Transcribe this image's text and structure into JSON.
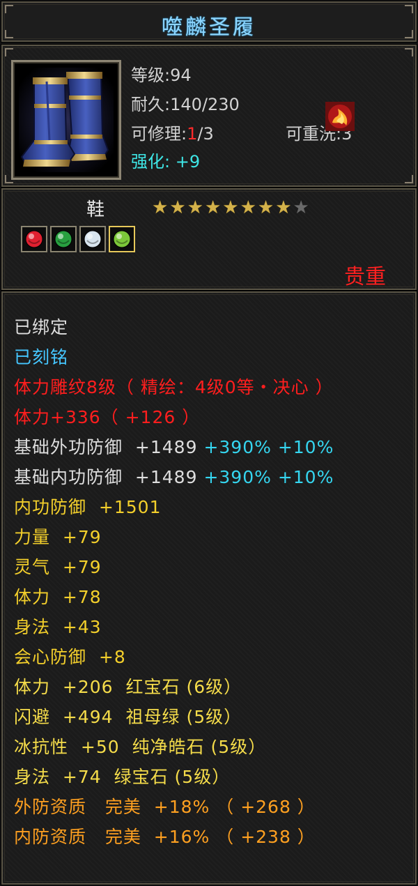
{
  "title": "噬麟圣履",
  "info": {
    "level_label": "等级:",
    "level_value": "94",
    "durability_label": "耐久:",
    "durability_value": "140/230",
    "repair_label": "可修理:",
    "repair_current": "1",
    "repair_max": "/3",
    "reset_label": "可重洗:",
    "reset_value": "3",
    "enhance_label": "强化:",
    "enhance_value": "+9",
    "item_icon": "blue-boots-icon",
    "element_icon": "fire-phoenix-icon"
  },
  "item_type": "鞋",
  "stars": {
    "filled": 8,
    "total": 9
  },
  "gems": [
    {
      "name": "red-gem-icon",
      "color": "#e02030"
    },
    {
      "name": "emerald-gem-icon",
      "color": "#28a040"
    },
    {
      "name": "white-gem-icon",
      "color": "#d8e4ee"
    },
    {
      "name": "green-gem-icon",
      "color": "#7cc83a"
    }
  ],
  "rarity": "贵重",
  "attributes": {
    "bound": "已绑定",
    "engraved": "已刻铭",
    "carving": "体力雕纹8级（ 精绘：4级0等・决心 ）",
    "stamina_main": "体力+336（ +126 ）",
    "outer_def": {
      "label": "基础外功防御",
      "value": "+1489",
      "bonus1": "+390%",
      "bonus2": "+10%"
    },
    "inner_def": {
      "label": "基础内功防御",
      "value": "+1489",
      "bonus1": "+390%",
      "bonus2": "+10%"
    },
    "yellow_stats": [
      {
        "label": "内功防御",
        "value": "+1501"
      },
      {
        "label": "力量",
        "value": "+79"
      },
      {
        "label": "灵气",
        "value": "+79"
      },
      {
        "label": "体力",
        "value": "+78"
      },
      {
        "label": "身法",
        "value": "+43"
      },
      {
        "label": "会心防御",
        "value": "+8"
      }
    ],
    "gem_stats": [
      {
        "label": "体力",
        "value": "+206",
        "gem": "红宝石 (6级）"
      },
      {
        "label": "闪避",
        "value": "+494",
        "gem": "祖母绿 (5级）"
      },
      {
        "label": "冰抗性",
        "value": "+50",
        "gem": "纯净皓石 (5级）"
      },
      {
        "label": "身法",
        "value": "+74",
        "gem": "绿宝石 (5级）"
      }
    ],
    "qualities": [
      {
        "label": "外防资质",
        "grade": "完美",
        "value": "+18%",
        "extra": "（ +268 ）"
      },
      {
        "label": "内防资质",
        "grade": "完美",
        "value": "+16%",
        "extra": "（ +238 ）"
      }
    ]
  }
}
